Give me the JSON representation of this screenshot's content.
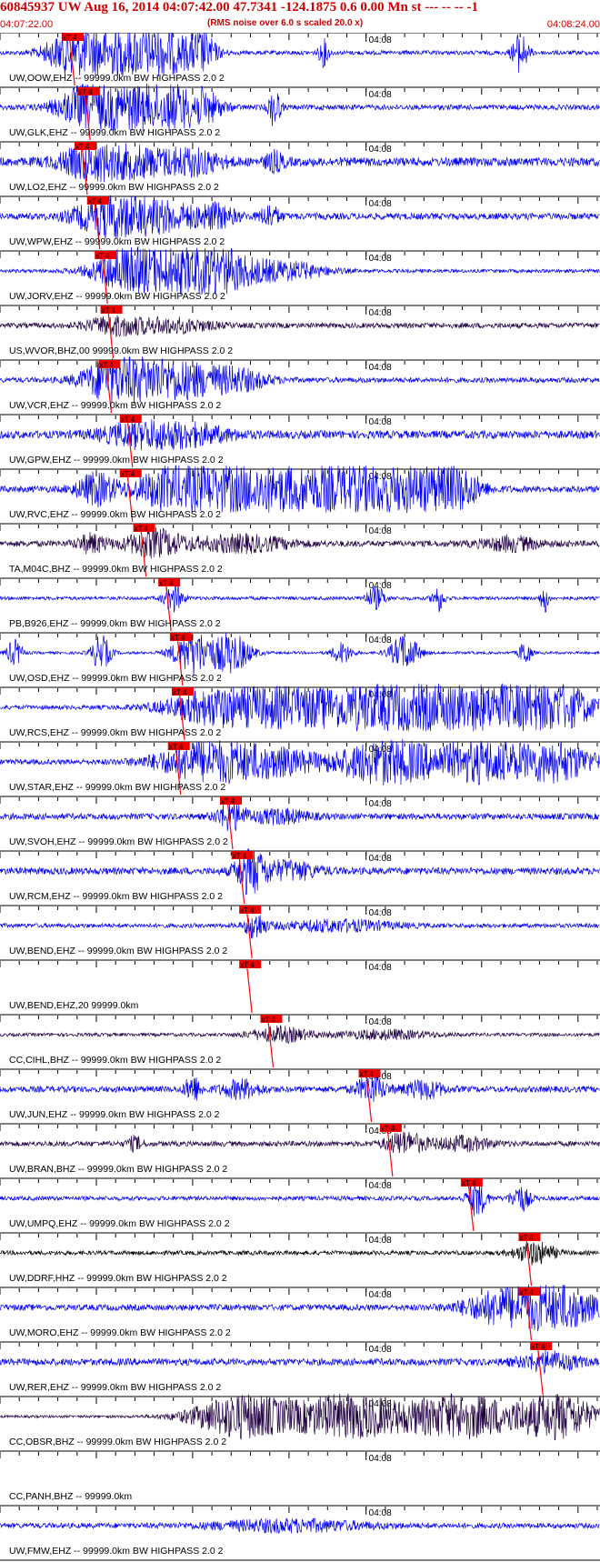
{
  "header": {
    "title": "60845937 UW Aug 16, 2014 04:07:42.00   47.7341 -124.1875  0.6 0.00 Mn st --- -- --  -1",
    "subtitle": "(RMS noise over 6.0 s scaled 20.0 x)",
    "start_time": "04:07:22.00",
    "end_time": "04:08:24.00"
  },
  "chart_data": {
    "type": "line",
    "title": "60845937 UW Aug 16, 2014 04:07:42.00   47.7341 -124.1875  0.6 0.00 Mn st --- -- --  -1",
    "subtitle": "(RMS noise over 6.0 s scaled 20.0 x)",
    "x_range": [
      "04:07:22.00",
      "04:08:24.00"
    ],
    "x_range_seconds": [
      0,
      62
    ],
    "center_tick_label": "04:08",
    "pick_label": "xT 4",
    "grid": false,
    "colors": {
      "blue": "#0000ee",
      "dark": "#220044",
      "black": "#000000",
      "red": "#ff0000",
      "pick_box": "#ee0000"
    },
    "traces": [
      {
        "label": "UW,OOW,EHZ -- 99999.0km BW  HIGHPASS  2.0  2",
        "pick_s": 7.0,
        "color": "blue",
        "base": 0.1,
        "events": [
          [
            7.0,
            0.8,
            2.5
          ],
          [
            9.5,
            1.0,
            2
          ],
          [
            12.5,
            1.0,
            3
          ],
          [
            15.0,
            0.9,
            2
          ],
          [
            17.0,
            0.9,
            3
          ],
          [
            21.0,
            0.8,
            1.5
          ],
          [
            33.6,
            0.6,
            0.5
          ],
          [
            54.0,
            0.9,
            0.8
          ]
        ]
      },
      {
        "label": "UW,GLK,EHZ -- 99999.0km BW  HIGHPASS  2.0  2",
        "pick_s": 8.6,
        "color": "blue",
        "base": 0.12,
        "events": [
          [
            9.0,
            1.0,
            3
          ],
          [
            12.0,
            0.9,
            2
          ],
          [
            14.5,
            1.0,
            3
          ],
          [
            17.5,
            0.9,
            2
          ],
          [
            21.0,
            0.8,
            2
          ],
          [
            28.5,
            0.9,
            0.6
          ]
        ]
      },
      {
        "label": "UW,LO2,EHZ -- 99999.0km BW  HIGHPASS  2.0  2",
        "pick_s": 8.3,
        "color": "blue",
        "base": 0.2,
        "events": [
          [
            9.0,
            0.6,
            3
          ],
          [
            14.0,
            0.6,
            4
          ],
          [
            20.0,
            0.5,
            3
          ],
          [
            28.5,
            0.4,
            1
          ]
        ]
      },
      {
        "label": "UW,WPW,EHZ -- 99999.0km BW  HIGHPASS  2.0  2",
        "pick_s": 9.6,
        "color": "blue",
        "base": 0.15,
        "events": [
          [
            10.5,
            0.7,
            3
          ],
          [
            14.0,
            0.6,
            3
          ],
          [
            18.0,
            0.5,
            3
          ],
          [
            22.5,
            0.5,
            2
          ],
          [
            28.0,
            0.5,
            1
          ]
        ]
      },
      {
        "label": "UW,JORV,EHZ -- 99999.0km BW  HIGHPASS  2.0  2",
        "pick_s": 10.4,
        "color": "blue",
        "base": 0.08,
        "events": [
          [
            14.0,
            1.0,
            4
          ],
          [
            18.5,
            1.0,
            5
          ],
          [
            23.0,
            0.7,
            4
          ],
          [
            30.0,
            0.4,
            4
          ]
        ]
      },
      {
        "label": "US,WVOR,BHZ,00 99999.0km BW  HIGHPASS  2.0  2",
        "pick_s": 11.0,
        "color": "dark",
        "base": 0.12,
        "events": [
          [
            12.0,
            0.4,
            3
          ],
          [
            18.0,
            0.3,
            4
          ]
        ]
      },
      {
        "label": "UW,VCR,EHZ -- 99999.0km BW  HIGHPASS  2.0  2",
        "pick_s": 10.8,
        "color": "blue",
        "base": 0.12,
        "events": [
          [
            11.5,
            0.8,
            3
          ],
          [
            15.0,
            0.7,
            4
          ],
          [
            20.0,
            0.6,
            4
          ],
          [
            25.0,
            0.4,
            3
          ]
        ]
      },
      {
        "label": "UW,GPW,EHZ -- 99999.0km BW  HIGHPASS  2.0  2",
        "pick_s": 13.0,
        "color": "blue",
        "base": 0.18,
        "events": [
          [
            14.5,
            0.5,
            4
          ],
          [
            20.0,
            0.4,
            4
          ]
        ]
      },
      {
        "label": "UW,RVC,EHZ -- 99999.0km BW  HIGHPASS  2.0  2",
        "pick_s": 13.0,
        "color": "blue",
        "base": 0.15,
        "events": [
          [
            10.0,
            0.7,
            2
          ],
          [
            18.0,
            0.9,
            4
          ],
          [
            24.0,
            1.0,
            5
          ],
          [
            31.0,
            1.0,
            5
          ],
          [
            37.0,
            1.0,
            5
          ],
          [
            44.0,
            0.9,
            4
          ],
          [
            48.0,
            0.6,
            2
          ]
        ]
      },
      {
        "label": "TA,M04C,BHZ -- 99999.0km BW  HIGHPASS  2.0  2",
        "pick_s": 14.4,
        "color": "dark",
        "base": 0.14,
        "events": [
          [
            9.5,
            0.4,
            1.5
          ],
          [
            16.0,
            0.6,
            3
          ],
          [
            25.0,
            0.35,
            5
          ],
          [
            53.0,
            0.3,
            3
          ]
        ]
      },
      {
        "label": "PB,B926,EHZ -- 99999.0km BW  HIGHPASS  2.0  2",
        "pick_s": 17.0,
        "color": "blue",
        "base": 0.08,
        "events": [
          [
            18.0,
            0.6,
            1
          ],
          [
            39.0,
            0.5,
            1
          ],
          [
            45.5,
            0.6,
            0.6
          ],
          [
            56.5,
            0.7,
            0.4
          ]
        ]
      },
      {
        "label": "UW,OSD,EHZ -- 99999.0km BW  HIGHPASS  2.0  2",
        "pick_s": 18.2,
        "color": "blue",
        "base": 0.06,
        "events": [
          [
            1.5,
            0.6,
            0.8
          ],
          [
            10.5,
            0.8,
            1
          ],
          [
            20.0,
            1.0,
            2
          ],
          [
            24.0,
            0.9,
            2
          ],
          [
            35.5,
            0.5,
            1
          ],
          [
            42.0,
            0.8,
            1.5
          ],
          [
            54.5,
            0.6,
            0.6
          ]
        ]
      },
      {
        "label": "UW,RCS,EHZ -- 99999.0km BW  HIGHPASS  2.0  2",
        "pick_s": 18.4,
        "color": "blue",
        "base": 0.1,
        "events": [
          [
            22.0,
            0.7,
            5
          ],
          [
            30.0,
            0.8,
            6
          ],
          [
            40.0,
            1.0,
            6
          ],
          [
            50.0,
            1.0,
            6
          ],
          [
            58.0,
            0.9,
            4
          ]
        ]
      },
      {
        "label": "UW,STAR,EHZ -- 99999.0km BW  HIGHPASS  2.0  2",
        "pick_s": 18.0,
        "color": "blue",
        "base": 0.12,
        "events": [
          [
            21.0,
            0.8,
            5
          ],
          [
            28.0,
            0.6,
            5
          ],
          [
            40.0,
            1.0,
            5
          ],
          [
            50.0,
            0.9,
            5
          ],
          [
            58.0,
            0.8,
            4
          ]
        ]
      },
      {
        "label": "UW,SVOH,EHZ -- 99999.0km BW  HIGHPASS  2.0  2",
        "pick_s": 23.4,
        "color": "blue",
        "base": 0.14,
        "events": [
          [
            24.0,
            0.6,
            1.5
          ],
          [
            29.0,
            0.3,
            3
          ]
        ]
      },
      {
        "label": "UW,RCM,EHZ -- 99999.0km BW  HIGHPASS  2.0  2",
        "pick_s": 24.6,
        "color": "blue",
        "base": 0.16,
        "events": [
          [
            26.0,
            1.0,
            1.5
          ],
          [
            30.0,
            0.4,
            3
          ]
        ]
      },
      {
        "label": "UW,BEND,EHZ -- 99999.0km BW  HIGHPASS  2.0  2",
        "pick_s": 25.4,
        "color": "blue",
        "base": 0.1,
        "events": [
          [
            26.5,
            0.6,
            1
          ],
          [
            35.0,
            0.25,
            6
          ]
        ]
      },
      {
        "label": "UW,BEND,EHZ,20 99999.0km",
        "pick_s": 25.4,
        "color": "none",
        "base": 0.0,
        "events": []
      },
      {
        "label": "CC,CIHL,BHZ -- 99999.0km BW  HIGHPASS  2.0  2",
        "pick_s": 27.6,
        "color": "dark",
        "base": 0.08,
        "events": [
          [
            29.0,
            0.35,
            3
          ],
          [
            40.0,
            0.2,
            5
          ]
        ]
      },
      {
        "label": "UW,JUN,EHZ -- 99999.0km BW  HIGHPASS  2.0  2",
        "pick_s": 37.8,
        "color": "blue",
        "base": 0.14,
        "events": [
          [
            20.0,
            0.6,
            0.8
          ],
          [
            25.0,
            0.4,
            2
          ],
          [
            38.5,
            0.6,
            1.5
          ],
          [
            44.0,
            0.4,
            2
          ]
        ]
      },
      {
        "label": "UW,BRAN,BHZ -- 99999.0km BW  HIGHPASS  2.0  2",
        "pick_s": 40.0,
        "color": "dark",
        "base": 0.12,
        "events": [
          [
            14.0,
            0.3,
            0.8
          ],
          [
            42.0,
            0.5,
            2
          ],
          [
            48.0,
            0.3,
            3
          ]
        ]
      },
      {
        "label": "UW,UMPQ,EHZ -- 99999.0km BW  HIGHPASS  2.0  2",
        "pick_s": 48.4,
        "color": "blue",
        "base": 0.1,
        "events": [
          [
            49.5,
            0.8,
            1
          ],
          [
            54.0,
            0.6,
            1
          ]
        ]
      },
      {
        "label": "UW,DDRF,HHZ -- 99999.0km BW  HIGHPASS  2.0  2",
        "pick_s": 54.4,
        "color": "black",
        "base": 0.1,
        "events": [
          [
            55.5,
            0.5,
            2
          ]
        ]
      },
      {
        "label": "UW,MORO,EHZ -- 99999.0km BW  HIGHPASS  2.0  2",
        "pick_s": 54.4,
        "color": "blue",
        "base": 0.14,
        "events": [
          [
            52.0,
            0.7,
            4
          ],
          [
            58.0,
            1.0,
            4
          ]
        ]
      },
      {
        "label": "UW,RER,EHZ -- 99999.0km BW  HIGHPASS  2.0  2",
        "pick_s": 55.6,
        "color": "blue",
        "base": 0.16,
        "events": [
          [
            57.0,
            0.4,
            3
          ]
        ]
      },
      {
        "label": "CC,OBSR,BHZ -- 99999.0km BW  HIGHPASS  2.0  2",
        "pick_s": null,
        "color": "dark",
        "base": 0.06,
        "events": [
          [
            25.0,
            1.0,
            5
          ],
          [
            36.0,
            1.0,
            6
          ],
          [
            48.0,
            1.0,
            6
          ],
          [
            58.0,
            1.0,
            4
          ]
        ]
      },
      {
        "label": "CC,PANH,BHZ -- 99999.0km",
        "pick_s": null,
        "color": "none",
        "base": 0.0,
        "events": []
      },
      {
        "label": "UW,FMW,EHZ -- 99999.0km BW  HIGHPASS  2.0  2",
        "pick_s": null,
        "color": "blue",
        "base": 0.12,
        "events": [
          [
            30.0,
            0.25,
            8
          ]
        ]
      }
    ]
  }
}
